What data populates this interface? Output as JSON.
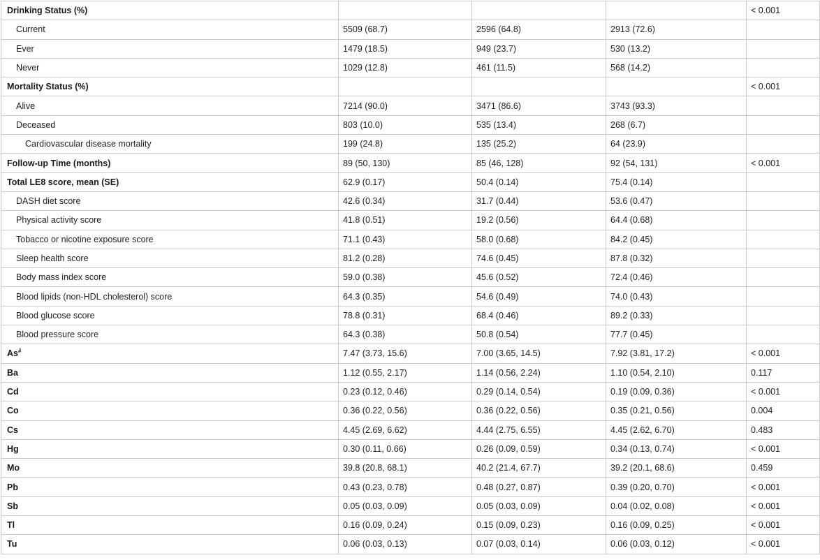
{
  "table": {
    "rows": [
      {
        "label": "Drinking Status (%)",
        "level": 0,
        "bold": true,
        "cells": [
          "",
          "",
          ""
        ],
        "p": "< 0.001"
      },
      {
        "label": "Current",
        "level": 1,
        "bold": false,
        "cells": [
          "5509 (68.7)",
          "2596 (64.8)",
          "2913 (72.6)"
        ],
        "p": ""
      },
      {
        "label": "Ever",
        "level": 1,
        "bold": false,
        "cells": [
          "1479 (18.5)",
          "949 (23.7)",
          "530 (13.2)"
        ],
        "p": ""
      },
      {
        "label": "Never",
        "level": 1,
        "bold": false,
        "cells": [
          "1029 (12.8)",
          "461 (11.5)",
          "568 (14.2)"
        ],
        "p": ""
      },
      {
        "label": "Mortality Status (%)",
        "level": 0,
        "bold": true,
        "cells": [
          "",
          "",
          ""
        ],
        "p": "< 0.001"
      },
      {
        "label": "Alive",
        "level": 1,
        "bold": false,
        "cells": [
          "7214 (90.0)",
          "3471 (86.6)",
          "3743 (93.3)"
        ],
        "p": ""
      },
      {
        "label": "Deceased",
        "level": 1,
        "bold": false,
        "cells": [
          "803 (10.0)",
          "535 (13.4)",
          "268 (6.7)"
        ],
        "p": ""
      },
      {
        "label": "Cardiovascular disease mortality",
        "level": 2,
        "bold": false,
        "cells": [
          "199 (24.8)",
          "135 (25.2)",
          "64 (23.9)"
        ],
        "p": ""
      },
      {
        "label": "Follow-up Time (months)",
        "level": 0,
        "bold": true,
        "cells": [
          "89 (50, 130)",
          "85 (46, 128)",
          "92 (54, 131)"
        ],
        "p": "< 0.001"
      },
      {
        "label": "Total LE8 score, mean (SE)",
        "level": 0,
        "bold": true,
        "cells": [
          "62.9 (0.17)",
          "50.4 (0.14)",
          "75.4 (0.14)"
        ],
        "p": ""
      },
      {
        "label": "DASH diet score",
        "level": 1,
        "bold": false,
        "cells": [
          "42.6 (0.34)",
          "31.7 (0.44)",
          "53.6 (0.47)"
        ],
        "p": ""
      },
      {
        "label": "Physical activity score",
        "level": 1,
        "bold": false,
        "cells": [
          "41.8 (0.51)",
          "19.2 (0.56)",
          "64.4 (0.68)"
        ],
        "p": ""
      },
      {
        "label": "Tobacco or nicotine exposure score",
        "level": 1,
        "bold": false,
        "cells": [
          "71.1 (0.43)",
          "58.0 (0.68)",
          "84.2 (0.45)"
        ],
        "p": ""
      },
      {
        "label": "Sleep health score",
        "level": 1,
        "bold": false,
        "cells": [
          "81.2 (0.28)",
          "74.6 (0.45)",
          "87.8 (0.32)"
        ],
        "p": ""
      },
      {
        "label": "Body mass index score",
        "level": 1,
        "bold": false,
        "cells": [
          "59.0 (0.38)",
          "45.6 (0.52)",
          "72.4 (0.46)"
        ],
        "p": ""
      },
      {
        "label": "Blood lipids (non-HDL cholesterol) score",
        "level": 1,
        "bold": false,
        "cells": [
          "64.3 (0.35)",
          "54.6 (0.49)",
          "74.0 (0.43)"
        ],
        "p": ""
      },
      {
        "label": "Blood glucose score",
        "level": 1,
        "bold": false,
        "cells": [
          "78.8 (0.31)",
          "68.4 (0.46)",
          "89.2 (0.33)"
        ],
        "p": ""
      },
      {
        "label": "Blood pressure score",
        "level": 1,
        "bold": false,
        "cells": [
          "64.3 (0.38)",
          "50.8 (0.54)",
          "77.7 (0.45)"
        ],
        "p": ""
      },
      {
        "label": "As",
        "sup": "#",
        "level": 0,
        "bold": true,
        "cells": [
          "7.47 (3.73, 15.6)",
          "7.00 (3.65, 14.5)",
          "7.92 (3.81, 17.2)"
        ],
        "p": "< 0.001"
      },
      {
        "label": "Ba",
        "level": 0,
        "bold": true,
        "cells": [
          "1.12 (0.55, 2.17)",
          "1.14 (0.56, 2.24)",
          "1.10 (0.54, 2.10)"
        ],
        "p": "0.117"
      },
      {
        "label": "Cd",
        "level": 0,
        "bold": true,
        "cells": [
          "0.23 (0.12, 0.46)",
          "0.29 (0.14, 0.54)",
          "0.19 (0.09, 0.36)"
        ],
        "p": "< 0.001"
      },
      {
        "label": "Co",
        "level": 0,
        "bold": true,
        "cells": [
          "0.36 (0.22, 0.56)",
          "0.36 (0.22, 0.56)",
          "0.35 (0.21, 0.56)"
        ],
        "p": "0.004"
      },
      {
        "label": "Cs",
        "level": 0,
        "bold": true,
        "cells": [
          "4.45 (2.69, 6.62)",
          "4.44 (2.75, 6.55)",
          "4.45 (2.62, 6.70)"
        ],
        "p": "0.483"
      },
      {
        "label": "Hg",
        "level": 0,
        "bold": true,
        "cells": [
          "0.30 (0.11, 0.66)",
          "0.26 (0.09, 0.59)",
          "0.34 (0.13, 0.74)"
        ],
        "p": "< 0.001"
      },
      {
        "label": "Mo",
        "level": 0,
        "bold": true,
        "cells": [
          "39.8 (20.8, 68.1)",
          "40.2 (21.4, 67.7)",
          "39.2 (20.1, 68.6)"
        ],
        "p": "0.459"
      },
      {
        "label": "Pb",
        "level": 0,
        "bold": true,
        "cells": [
          "0.43 (0.23, 0.78)",
          "0.48 (0.27, 0.87)",
          "0.39 (0.20, 0.70)"
        ],
        "p": "< 0.001"
      },
      {
        "label": "Sb",
        "level": 0,
        "bold": true,
        "cells": [
          "0.05 (0.03, 0.09)",
          "0.05 (0.03, 0.09)",
          "0.04 (0.02, 0.08)"
        ],
        "p": "< 0.001"
      },
      {
        "label": "Tl",
        "level": 0,
        "bold": true,
        "cells": [
          "0.16 (0.09, 0.24)",
          "0.15 (0.09, 0.23)",
          "0.16 (0.09, 0.25)"
        ],
        "p": "< 0.001"
      },
      {
        "label": "Tu",
        "level": 0,
        "bold": true,
        "cells": [
          "0.06 (0.03, 0.13)",
          "0.07 (0.03, 0.14)",
          "0.06 (0.03, 0.12)"
        ],
        "p": "< 0.001"
      }
    ]
  }
}
